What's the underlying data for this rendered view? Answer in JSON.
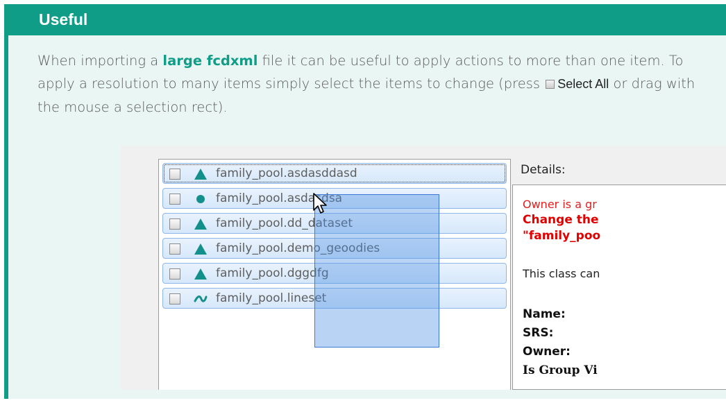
{
  "callout": {
    "title": "Useful",
    "text": {
      "part1": "When importing a ",
      "highlight": "large fcdxml",
      "part2": " file it can be useful to apply actions to more than one item. To apply a resolution to many items simply select the items to change (press ",
      "select_all": "Select All",
      "part3": " or drag with the mouse a selection rect)."
    }
  },
  "screenshot": {
    "items": [
      {
        "label": "family_pool.asdasddasd",
        "icon": "triangle-icon"
      },
      {
        "label": "family_pool.asdasdsa",
        "icon": "circle-icon"
      },
      {
        "label": "family_pool.dd_dataset",
        "icon": "triangle-icon"
      },
      {
        "label": "family_pool.demo_geoodies",
        "icon": "triangle-icon"
      },
      {
        "label": "family_pool.dggdfg",
        "icon": "triangle-icon"
      },
      {
        "label": "family_pool.lineset",
        "icon": "wave-icon"
      }
    ],
    "details": {
      "label": "Details:",
      "warning": "Owner is a gr",
      "change_line1": "Change the",
      "change_line2": "\"family_poo",
      "info": "This class can",
      "fields": [
        "Name:",
        "SRS:",
        "Owner:",
        "Is Group Vi"
      ]
    }
  },
  "colors": {
    "accent": "#0f9d87",
    "callout_bg": "#eaf6f3",
    "icon": "#138f8c",
    "error": "#e00000",
    "selection": "#3b78d4"
  }
}
